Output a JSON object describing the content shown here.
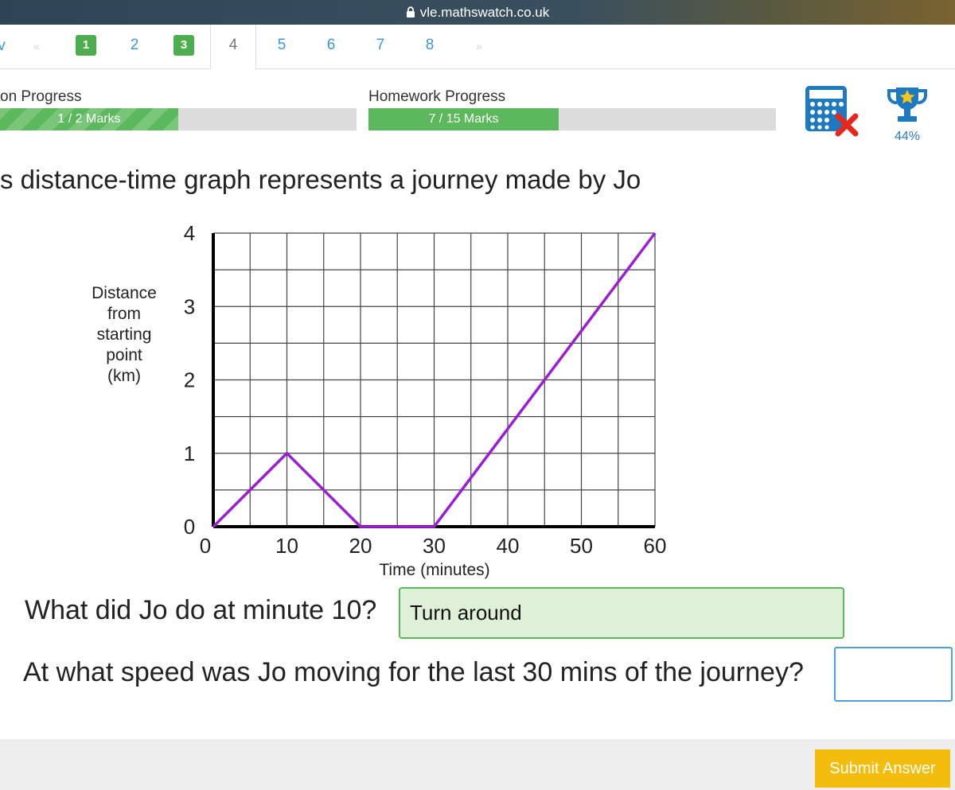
{
  "browser": {
    "url": "vle.mathswatch.co.uk"
  },
  "pagination": {
    "prev_fragment": "v",
    "first_arrow": "«",
    "last_arrow": "»",
    "pages": [
      "1",
      "2",
      "3",
      "4",
      "5",
      "6",
      "7",
      "8"
    ],
    "completed": [
      "1",
      "3"
    ],
    "current": "4"
  },
  "progress": {
    "lesson": {
      "label": "on Progress",
      "text": "1 / 2 Marks",
      "fraction": 0.5
    },
    "homework": {
      "label": "Homework Progress",
      "text": "7 / 15 Marks",
      "fraction": 0.4667
    },
    "score_percent": "44%"
  },
  "question": {
    "title": "s distance-time graph represents a journey made by Jo",
    "part1": {
      "prompt": "What did Jo do at minute 10?",
      "answer": "Turn around"
    },
    "part2": {
      "prompt": "At what speed was Jo moving for the last 30 mins of the journey?",
      "answer": ""
    }
  },
  "chart_data": {
    "type": "line",
    "xlabel": "Time (minutes)",
    "ylabel_lines": [
      "Distance",
      "from",
      "starting",
      "point",
      "(km)"
    ],
    "x_ticks": [
      0,
      10,
      20,
      30,
      40,
      50,
      60
    ],
    "y_ticks": [
      0,
      1,
      2,
      3,
      4
    ],
    "xlim": [
      0,
      60
    ],
    "ylim": [
      0,
      4
    ],
    "grid": true,
    "series": [
      {
        "x": [
          0,
          10,
          20,
          30,
          60
        ],
        "y": [
          0,
          1,
          0,
          0,
          4
        ],
        "color": "#9b1fd2"
      }
    ]
  },
  "colors": {
    "success": "#5cb85c",
    "link": "#3a9ad9",
    "accent_yellow": "#f5bd0b",
    "line": "#9b1fd2"
  },
  "icons": {
    "calculator": "calculator-disabled-icon",
    "trophy": "trophy-icon",
    "lock": "lock-icon"
  },
  "buttons": {
    "submit": "Submit Answer"
  }
}
